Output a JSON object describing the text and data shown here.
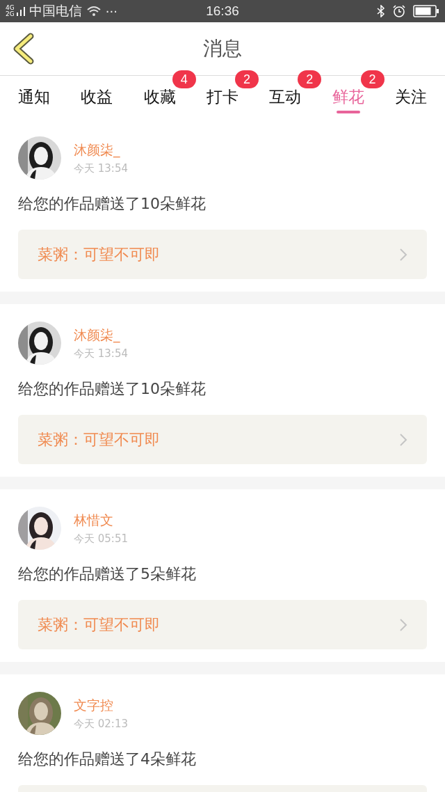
{
  "status_bar": {
    "network": [
      "4G",
      "2G"
    ],
    "carrier": "中国电信",
    "more": "···",
    "time": "16:36"
  },
  "header": {
    "title": "消息"
  },
  "tabs": [
    {
      "label": "通知",
      "selected": false
    },
    {
      "label": "收益",
      "selected": false
    },
    {
      "label": "收藏",
      "selected": false,
      "badge": "4"
    },
    {
      "label": "打卡",
      "selected": false,
      "badge": "2"
    },
    {
      "label": "互动",
      "selected": false,
      "badge": "2"
    },
    {
      "label": "鲜花",
      "selected": true,
      "badge": "2"
    },
    {
      "label": "关注",
      "selected": false
    }
  ],
  "messages": [
    {
      "user": "沐颜柒_",
      "time": "今天 13:54",
      "text": "给您的作品赠送了10朵鲜花",
      "quote": "菜粥：可望不可即"
    },
    {
      "user": "沐颜柒_",
      "time": "今天 13:54",
      "text": "给您的作品赠送了10朵鲜花",
      "quote": "菜粥：可望不可即"
    },
    {
      "user": "林惜文",
      "time": "今天 05:51",
      "text": "给您的作品赠送了5朵鲜花",
      "quote": "菜粥：可望不可即"
    },
    {
      "user": "文字控",
      "time": "今天 02:13",
      "text": "给您的作品赠送了4朵鲜花"
    }
  ]
}
